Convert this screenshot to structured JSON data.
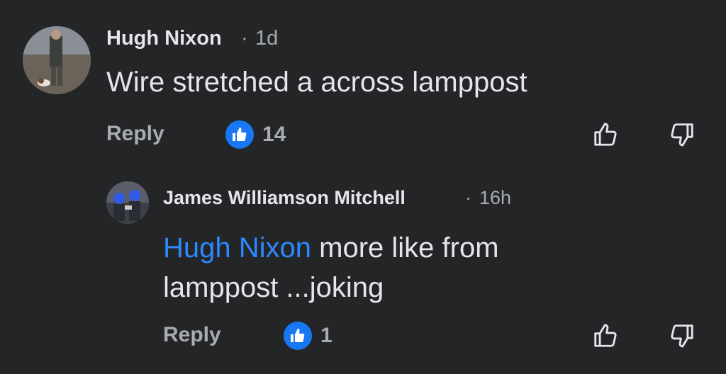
{
  "comments": [
    {
      "author": "Hugh Nixon",
      "separator": "·",
      "time": "1d",
      "text": "Wire stretched a across lamppost",
      "reply_label": "Reply",
      "reaction": {
        "icon": "thumbs-up-icon",
        "count": "14"
      },
      "like_icon": "thumbs-up-outline-icon",
      "dislike_icon": "thumbs-down-outline-icon"
    },
    {
      "author": "James Williamson Mitchell",
      "separator": "·",
      "time": "16h",
      "mention": "Hugh Nixon",
      "text_line1": " more like from",
      "text_line2": "lamppost ...joking",
      "reply_label": "Reply",
      "reaction": {
        "icon": "thumbs-up-icon",
        "count": "1"
      },
      "like_icon": "thumbs-up-outline-icon",
      "dislike_icon": "thumbs-down-outline-icon"
    }
  ],
  "colors": {
    "background": "#242526",
    "text": "#e4e6eb",
    "secondary": "#a8abaf",
    "mention": "#2d88ff",
    "reaction_badge": "#1877f2"
  }
}
